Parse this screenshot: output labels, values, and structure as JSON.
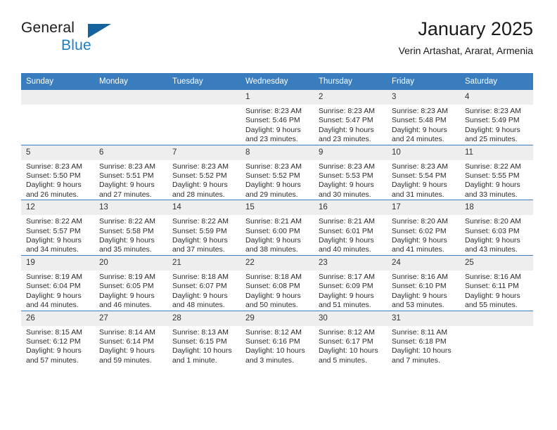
{
  "brand": {
    "word_one": "General",
    "word_two": "Blue",
    "logo_icon": "triangle-flag-icon",
    "accent_color": "#14639f",
    "text_color": "#1c7fc4"
  },
  "header": {
    "title": "January 2025",
    "subtitle": "Verin Artashat, Ararat, Armenia"
  },
  "theme": {
    "header_band": "#3a7dbf",
    "daynum_band": "#eeeeee",
    "grid_line": "#3a7dbf"
  },
  "columns": [
    "Sunday",
    "Monday",
    "Tuesday",
    "Wednesday",
    "Thursday",
    "Friday",
    "Saturday"
  ],
  "weeks": [
    [
      {
        "day": "",
        "blank": true,
        "sunrise": "",
        "sunset": "",
        "daylight_1": "",
        "daylight_2": ""
      },
      {
        "day": "",
        "blank": true,
        "sunrise": "",
        "sunset": "",
        "daylight_1": "",
        "daylight_2": ""
      },
      {
        "day": "",
        "blank": true,
        "sunrise": "",
        "sunset": "",
        "daylight_1": "",
        "daylight_2": ""
      },
      {
        "day": "1",
        "blank": false,
        "sunrise": "Sunrise: 8:23 AM",
        "sunset": "Sunset: 5:46 PM",
        "daylight_1": "Daylight: 9 hours",
        "daylight_2": "and 23 minutes."
      },
      {
        "day": "2",
        "blank": false,
        "sunrise": "Sunrise: 8:23 AM",
        "sunset": "Sunset: 5:47 PM",
        "daylight_1": "Daylight: 9 hours",
        "daylight_2": "and 23 minutes."
      },
      {
        "day": "3",
        "blank": false,
        "sunrise": "Sunrise: 8:23 AM",
        "sunset": "Sunset: 5:48 PM",
        "daylight_1": "Daylight: 9 hours",
        "daylight_2": "and 24 minutes."
      },
      {
        "day": "4",
        "blank": false,
        "sunrise": "Sunrise: 8:23 AM",
        "sunset": "Sunset: 5:49 PM",
        "daylight_1": "Daylight: 9 hours",
        "daylight_2": "and 25 minutes."
      }
    ],
    [
      {
        "day": "5",
        "blank": false,
        "sunrise": "Sunrise: 8:23 AM",
        "sunset": "Sunset: 5:50 PM",
        "daylight_1": "Daylight: 9 hours",
        "daylight_2": "and 26 minutes."
      },
      {
        "day": "6",
        "blank": false,
        "sunrise": "Sunrise: 8:23 AM",
        "sunset": "Sunset: 5:51 PM",
        "daylight_1": "Daylight: 9 hours",
        "daylight_2": "and 27 minutes."
      },
      {
        "day": "7",
        "blank": false,
        "sunrise": "Sunrise: 8:23 AM",
        "sunset": "Sunset: 5:52 PM",
        "daylight_1": "Daylight: 9 hours",
        "daylight_2": "and 28 minutes."
      },
      {
        "day": "8",
        "blank": false,
        "sunrise": "Sunrise: 8:23 AM",
        "sunset": "Sunset: 5:52 PM",
        "daylight_1": "Daylight: 9 hours",
        "daylight_2": "and 29 minutes."
      },
      {
        "day": "9",
        "blank": false,
        "sunrise": "Sunrise: 8:23 AM",
        "sunset": "Sunset: 5:53 PM",
        "daylight_1": "Daylight: 9 hours",
        "daylight_2": "and 30 minutes."
      },
      {
        "day": "10",
        "blank": false,
        "sunrise": "Sunrise: 8:23 AM",
        "sunset": "Sunset: 5:54 PM",
        "daylight_1": "Daylight: 9 hours",
        "daylight_2": "and 31 minutes."
      },
      {
        "day": "11",
        "blank": false,
        "sunrise": "Sunrise: 8:22 AM",
        "sunset": "Sunset: 5:55 PM",
        "daylight_1": "Daylight: 9 hours",
        "daylight_2": "and 33 minutes."
      }
    ],
    [
      {
        "day": "12",
        "blank": false,
        "sunrise": "Sunrise: 8:22 AM",
        "sunset": "Sunset: 5:57 PM",
        "daylight_1": "Daylight: 9 hours",
        "daylight_2": "and 34 minutes."
      },
      {
        "day": "13",
        "blank": false,
        "sunrise": "Sunrise: 8:22 AM",
        "sunset": "Sunset: 5:58 PM",
        "daylight_1": "Daylight: 9 hours",
        "daylight_2": "and 35 minutes."
      },
      {
        "day": "14",
        "blank": false,
        "sunrise": "Sunrise: 8:22 AM",
        "sunset": "Sunset: 5:59 PM",
        "daylight_1": "Daylight: 9 hours",
        "daylight_2": "and 37 minutes."
      },
      {
        "day": "15",
        "blank": false,
        "sunrise": "Sunrise: 8:21 AM",
        "sunset": "Sunset: 6:00 PM",
        "daylight_1": "Daylight: 9 hours",
        "daylight_2": "and 38 minutes."
      },
      {
        "day": "16",
        "blank": false,
        "sunrise": "Sunrise: 8:21 AM",
        "sunset": "Sunset: 6:01 PM",
        "daylight_1": "Daylight: 9 hours",
        "daylight_2": "and 40 minutes."
      },
      {
        "day": "17",
        "blank": false,
        "sunrise": "Sunrise: 8:20 AM",
        "sunset": "Sunset: 6:02 PM",
        "daylight_1": "Daylight: 9 hours",
        "daylight_2": "and 41 minutes."
      },
      {
        "day": "18",
        "blank": false,
        "sunrise": "Sunrise: 8:20 AM",
        "sunset": "Sunset: 6:03 PM",
        "daylight_1": "Daylight: 9 hours",
        "daylight_2": "and 43 minutes."
      }
    ],
    [
      {
        "day": "19",
        "blank": false,
        "sunrise": "Sunrise: 8:19 AM",
        "sunset": "Sunset: 6:04 PM",
        "daylight_1": "Daylight: 9 hours",
        "daylight_2": "and 44 minutes."
      },
      {
        "day": "20",
        "blank": false,
        "sunrise": "Sunrise: 8:19 AM",
        "sunset": "Sunset: 6:05 PM",
        "daylight_1": "Daylight: 9 hours",
        "daylight_2": "and 46 minutes."
      },
      {
        "day": "21",
        "blank": false,
        "sunrise": "Sunrise: 8:18 AM",
        "sunset": "Sunset: 6:07 PM",
        "daylight_1": "Daylight: 9 hours",
        "daylight_2": "and 48 minutes."
      },
      {
        "day": "22",
        "blank": false,
        "sunrise": "Sunrise: 8:18 AM",
        "sunset": "Sunset: 6:08 PM",
        "daylight_1": "Daylight: 9 hours",
        "daylight_2": "and 50 minutes."
      },
      {
        "day": "23",
        "blank": false,
        "sunrise": "Sunrise: 8:17 AM",
        "sunset": "Sunset: 6:09 PM",
        "daylight_1": "Daylight: 9 hours",
        "daylight_2": "and 51 minutes."
      },
      {
        "day": "24",
        "blank": false,
        "sunrise": "Sunrise: 8:16 AM",
        "sunset": "Sunset: 6:10 PM",
        "daylight_1": "Daylight: 9 hours",
        "daylight_2": "and 53 minutes."
      },
      {
        "day": "25",
        "blank": false,
        "sunrise": "Sunrise: 8:16 AM",
        "sunset": "Sunset: 6:11 PM",
        "daylight_1": "Daylight: 9 hours",
        "daylight_2": "and 55 minutes."
      }
    ],
    [
      {
        "day": "26",
        "blank": false,
        "sunrise": "Sunrise: 8:15 AM",
        "sunset": "Sunset: 6:12 PM",
        "daylight_1": "Daylight: 9 hours",
        "daylight_2": "and 57 minutes."
      },
      {
        "day": "27",
        "blank": false,
        "sunrise": "Sunrise: 8:14 AM",
        "sunset": "Sunset: 6:14 PM",
        "daylight_1": "Daylight: 9 hours",
        "daylight_2": "and 59 minutes."
      },
      {
        "day": "28",
        "blank": false,
        "sunrise": "Sunrise: 8:13 AM",
        "sunset": "Sunset: 6:15 PM",
        "daylight_1": "Daylight: 10 hours",
        "daylight_2": "and 1 minute."
      },
      {
        "day": "29",
        "blank": false,
        "sunrise": "Sunrise: 8:12 AM",
        "sunset": "Sunset: 6:16 PM",
        "daylight_1": "Daylight: 10 hours",
        "daylight_2": "and 3 minutes."
      },
      {
        "day": "30",
        "blank": false,
        "sunrise": "Sunrise: 8:12 AM",
        "sunset": "Sunset: 6:17 PM",
        "daylight_1": "Daylight: 10 hours",
        "daylight_2": "and 5 minutes."
      },
      {
        "day": "31",
        "blank": false,
        "sunrise": "Sunrise: 8:11 AM",
        "sunset": "Sunset: 6:18 PM",
        "daylight_1": "Daylight: 10 hours",
        "daylight_2": "and 7 minutes."
      },
      {
        "day": "",
        "blank": true,
        "sunrise": "",
        "sunset": "",
        "daylight_1": "",
        "daylight_2": ""
      }
    ]
  ]
}
